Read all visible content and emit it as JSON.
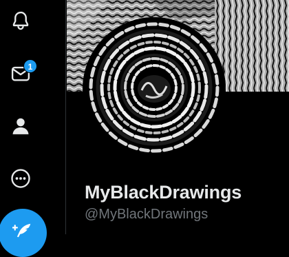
{
  "nav": {
    "items": [
      {
        "id": "notifications",
        "icon": "bell-icon"
      },
      {
        "id": "messages",
        "icon": "envelope-icon",
        "badge": "1"
      },
      {
        "id": "profile",
        "icon": "person-icon"
      },
      {
        "id": "more",
        "icon": "more-circle-icon"
      }
    ],
    "compose_icon": "feather-plus-icon"
  },
  "profile": {
    "display_name": "MyBlackDrawings",
    "handle": "@MyBlackDrawings"
  },
  "colors": {
    "background": "#000000",
    "accent": "#1d9bf0",
    "primary_text": "#e7e9ea",
    "secondary_text": "#71767b",
    "divider": "#2f3336"
  }
}
